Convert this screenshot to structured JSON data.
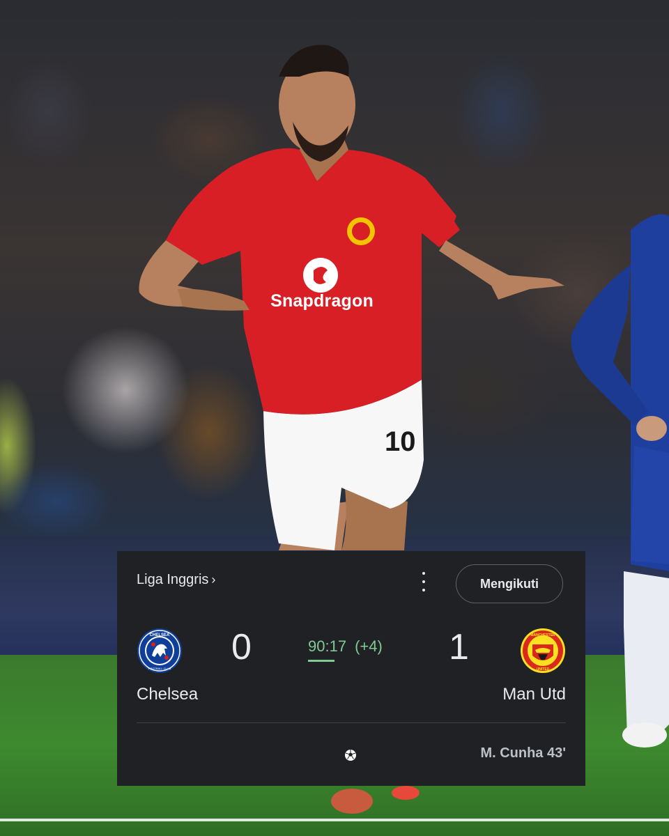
{
  "photo": {
    "sponsor_text": "Snapdragon",
    "shirt_number": "10"
  },
  "match_card": {
    "league": "Liga Inggris",
    "league_chevron": "›",
    "menu_icon": "more-vert-icon",
    "follow_label": "Mengikuti",
    "home": {
      "name": "Chelsea",
      "score": "0",
      "logo_text": "CHELSEA",
      "logo_sub": "FOOTBALL CLUB",
      "colors": {
        "primary": "#0f3f99",
        "secondary": "#ffffff"
      }
    },
    "away": {
      "name": "Man Utd",
      "score": "1",
      "logo_text": "MANCHESTER",
      "logo_sub": "UNITED",
      "colors": {
        "primary": "#da291c",
        "secondary": "#fbe122"
      }
    },
    "clock": "90:17",
    "added_time": "(+4)",
    "goal_icon": "soccer-ball-icon",
    "scorers": [
      "M. Cunha 43'"
    ],
    "colors": {
      "card_bg": "#202124",
      "live": "#81c995",
      "text": "#e8eaed"
    }
  }
}
